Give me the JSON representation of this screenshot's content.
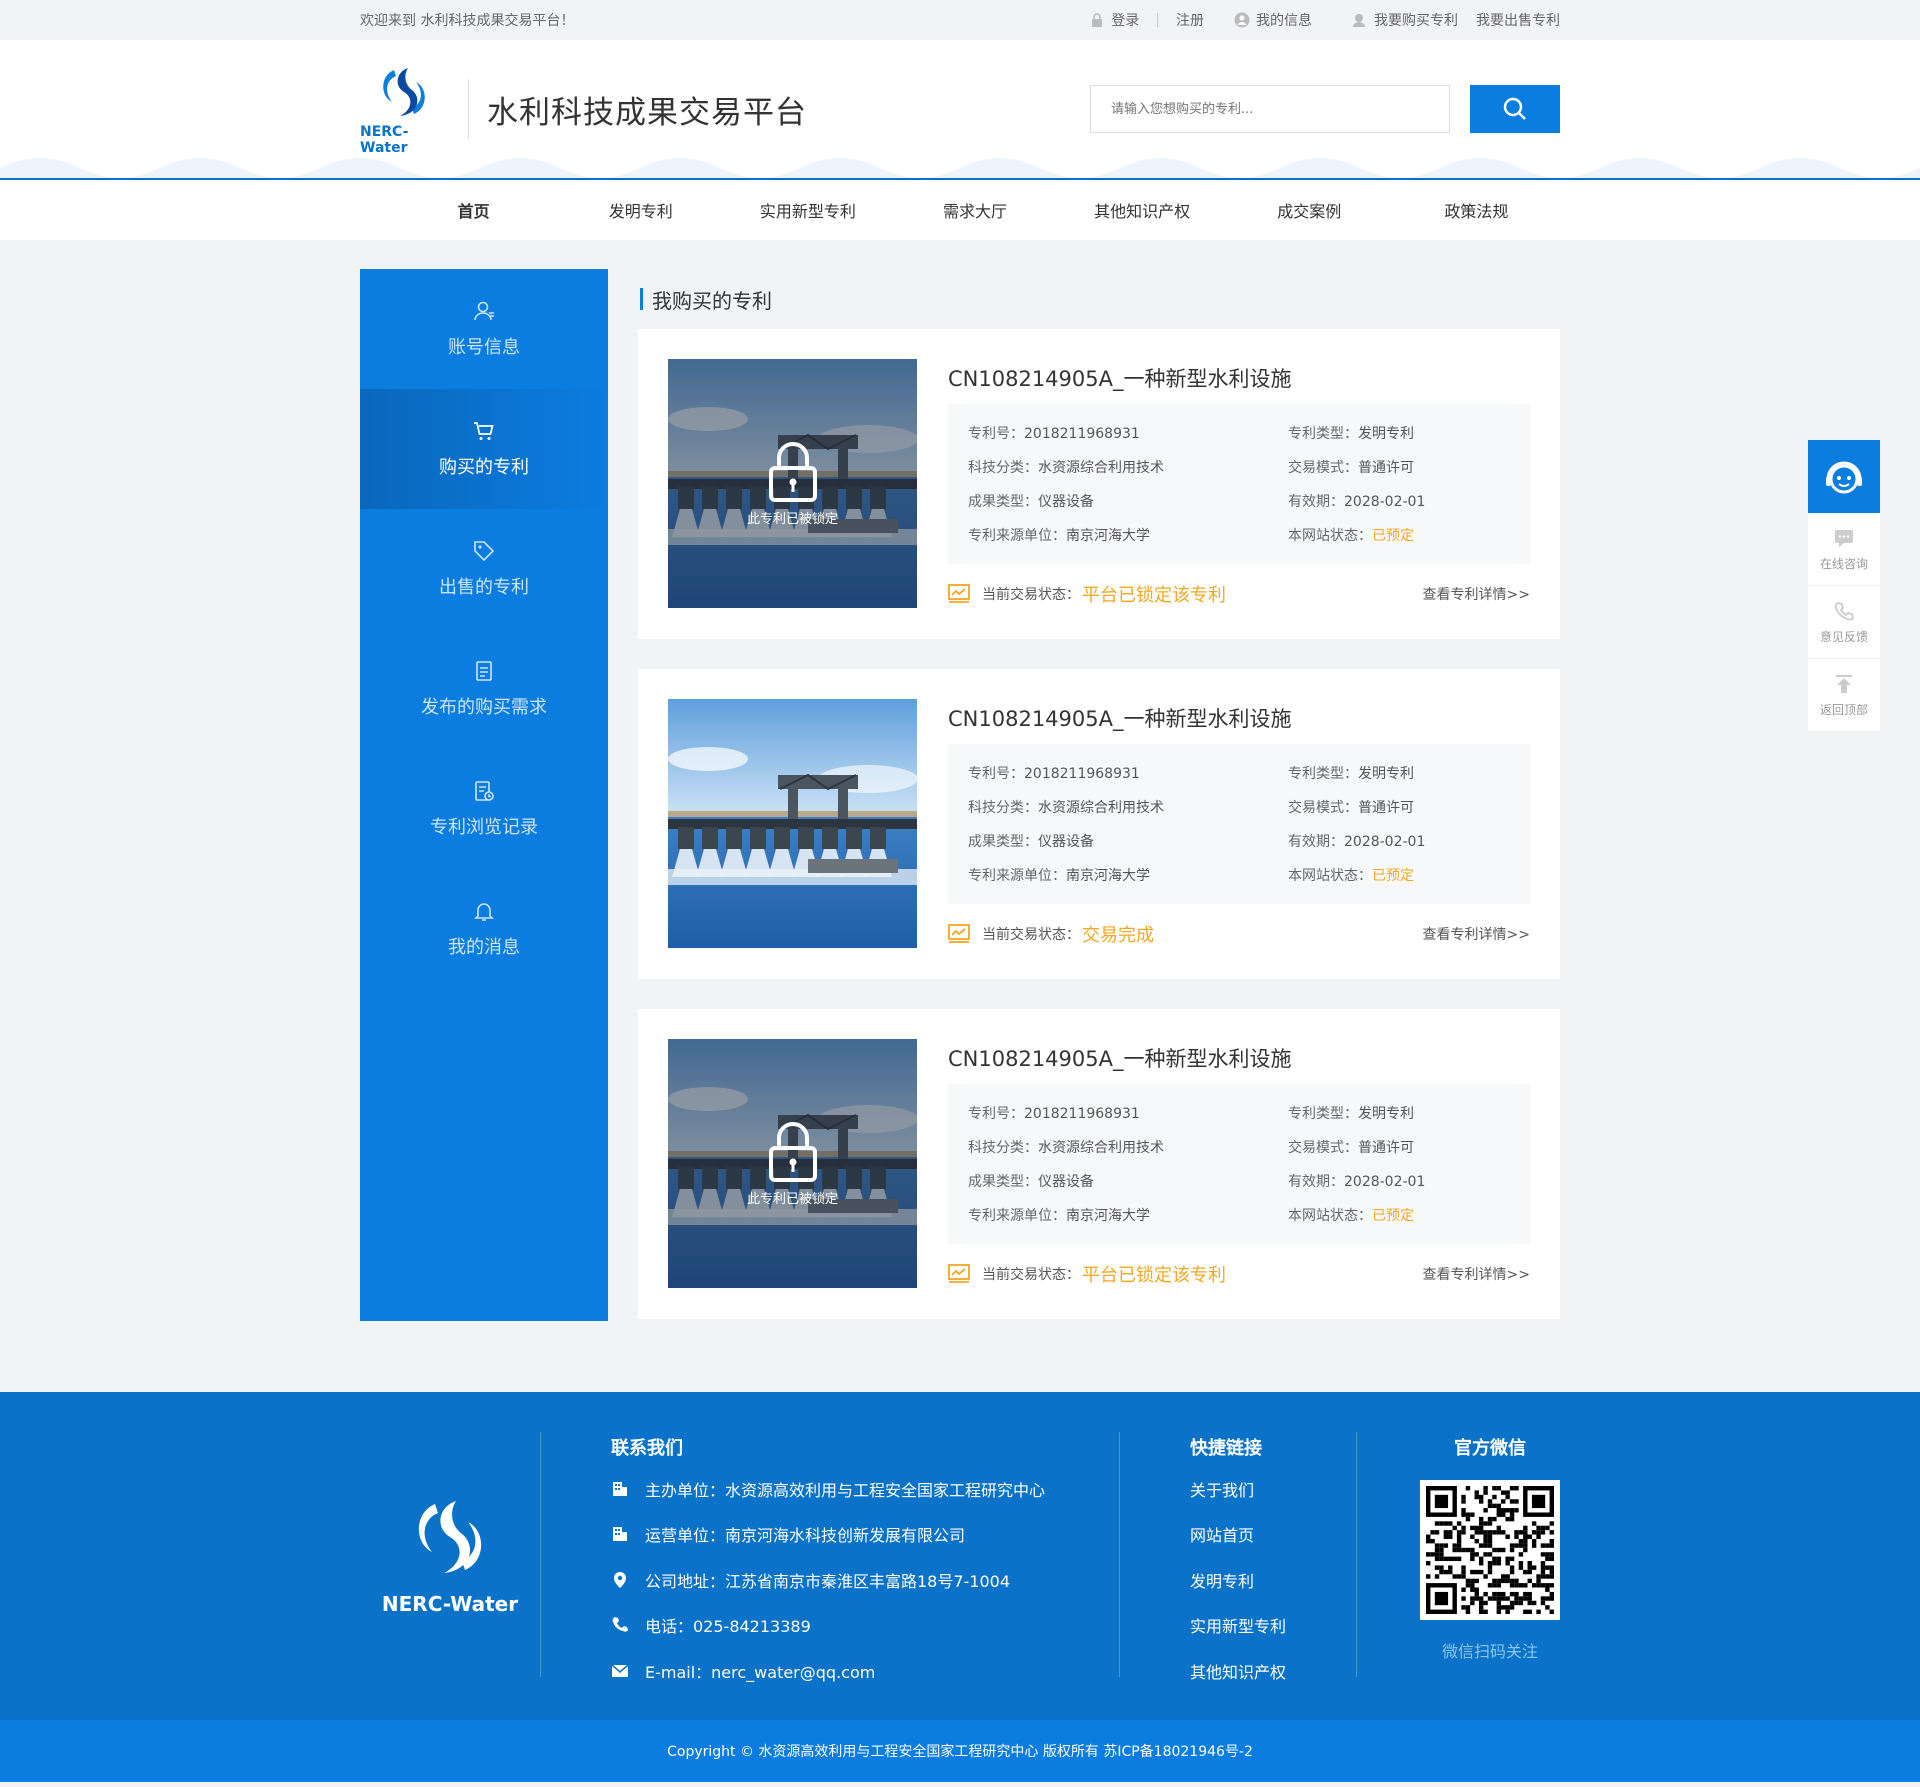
{
  "topbar": {
    "welcome": "欢迎来到  水利科技成果交易平台！",
    "login": "登录",
    "register": "注册",
    "my_info": "我的信息",
    "buy_patent": "我要购买专利",
    "sell_patent": "我要出售专利"
  },
  "header": {
    "brand": "NERC-Water",
    "site_title": "水利科技成果交易平台",
    "search_placeholder": "请输入您想购买的专利..."
  },
  "nav": [
    "首页",
    "发明专利",
    "实用新型专利",
    "需求大厅",
    "其他知识产权",
    "成交案例",
    "政策法规"
  ],
  "sidebar": [
    {
      "label": "账号信息",
      "icon": "user-icon"
    },
    {
      "label": "购买的专利",
      "icon": "cart-icon",
      "active": true
    },
    {
      "label": "出售的专利",
      "icon": "tag-icon"
    },
    {
      "label": "发布的购买需求",
      "icon": "document-icon"
    },
    {
      "label": "专利浏览记录",
      "icon": "history-icon"
    },
    {
      "label": "我的消息",
      "icon": "bell-icon"
    }
  ],
  "content": {
    "title": "我购买的专利",
    "labels": {
      "patent_no": "专利号：",
      "patent_type": "专利类型：",
      "category": "科技分类：",
      "trade_mode": "交易模式：",
      "result_type": "成果类型：",
      "valid": "有效期：",
      "source": "专利来源单位：",
      "site_status": "本网站状态：",
      "trade_status": "当前交易状态：",
      "detail_link": "查看专利详情>>",
      "locked_text": "此专利已被锁定"
    },
    "cards": [
      {
        "title": "CN108214905A_一种新型水利设施",
        "patent_no": "2018211968931",
        "patent_type": "发明专利",
        "category": "水资源综合利用技术",
        "trade_mode": "普通许可",
        "result_type": "仪器设备",
        "valid": "2028-02-01",
        "source": "南京河海大学",
        "site_status": "已预定",
        "trade_status": "平台已锁定该专利",
        "locked": true
      },
      {
        "title": "CN108214905A_一种新型水利设施",
        "patent_no": "2018211968931",
        "patent_type": "发明专利",
        "category": "水资源综合利用技术",
        "trade_mode": "普通许可",
        "result_type": "仪器设备",
        "valid": "2028-02-01",
        "source": "南京河海大学",
        "site_status": "已预定",
        "trade_status": "交易完成",
        "locked": false
      },
      {
        "title": "CN108214905A_一种新型水利设施",
        "patent_no": "2018211968931",
        "patent_type": "发明专利",
        "category": "水资源综合利用技术",
        "trade_mode": "普通许可",
        "result_type": "仪器设备",
        "valid": "2028-02-01",
        "source": "南京河海大学",
        "site_status": "已预定",
        "trade_status": "平台已锁定该专利",
        "locked": true
      }
    ]
  },
  "float": {
    "consult": "在线咨询",
    "feedback": "意见反馈",
    "top": "返回顶部"
  },
  "footer": {
    "brand": "NERC-Water",
    "contact_title": "联系我们",
    "contacts": [
      {
        "icon": "building-icon",
        "text": "主办单位：水资源高效利用与工程安全国家工程研究中心"
      },
      {
        "icon": "building-icon",
        "text": "运营单位：南京河海水科技创新发展有限公司"
      },
      {
        "icon": "location-icon",
        "text": "公司地址：江苏省南京市秦淮区丰富路18号7-1004"
      },
      {
        "icon": "phone-icon",
        "text": "电话：025-84213389"
      },
      {
        "icon": "mail-icon",
        "text": "E-mail：nerc_water@qq.com"
      }
    ],
    "links_title": "快捷链接",
    "links": [
      "关于我们",
      "网站首页",
      "发明专利",
      "实用新型专利",
      "其他知识产权"
    ],
    "wechat_title": "官方微信",
    "wechat_tip": "微信扫码关注",
    "copyright": "Copyright © 水资源高效利用与工程安全国家工程研究中心 版权所有    苏ICP备18021946号-2"
  },
  "colors": {
    "primary": "#0b7de0",
    "footer": "#0b72c9",
    "warn": "#f5a623"
  }
}
